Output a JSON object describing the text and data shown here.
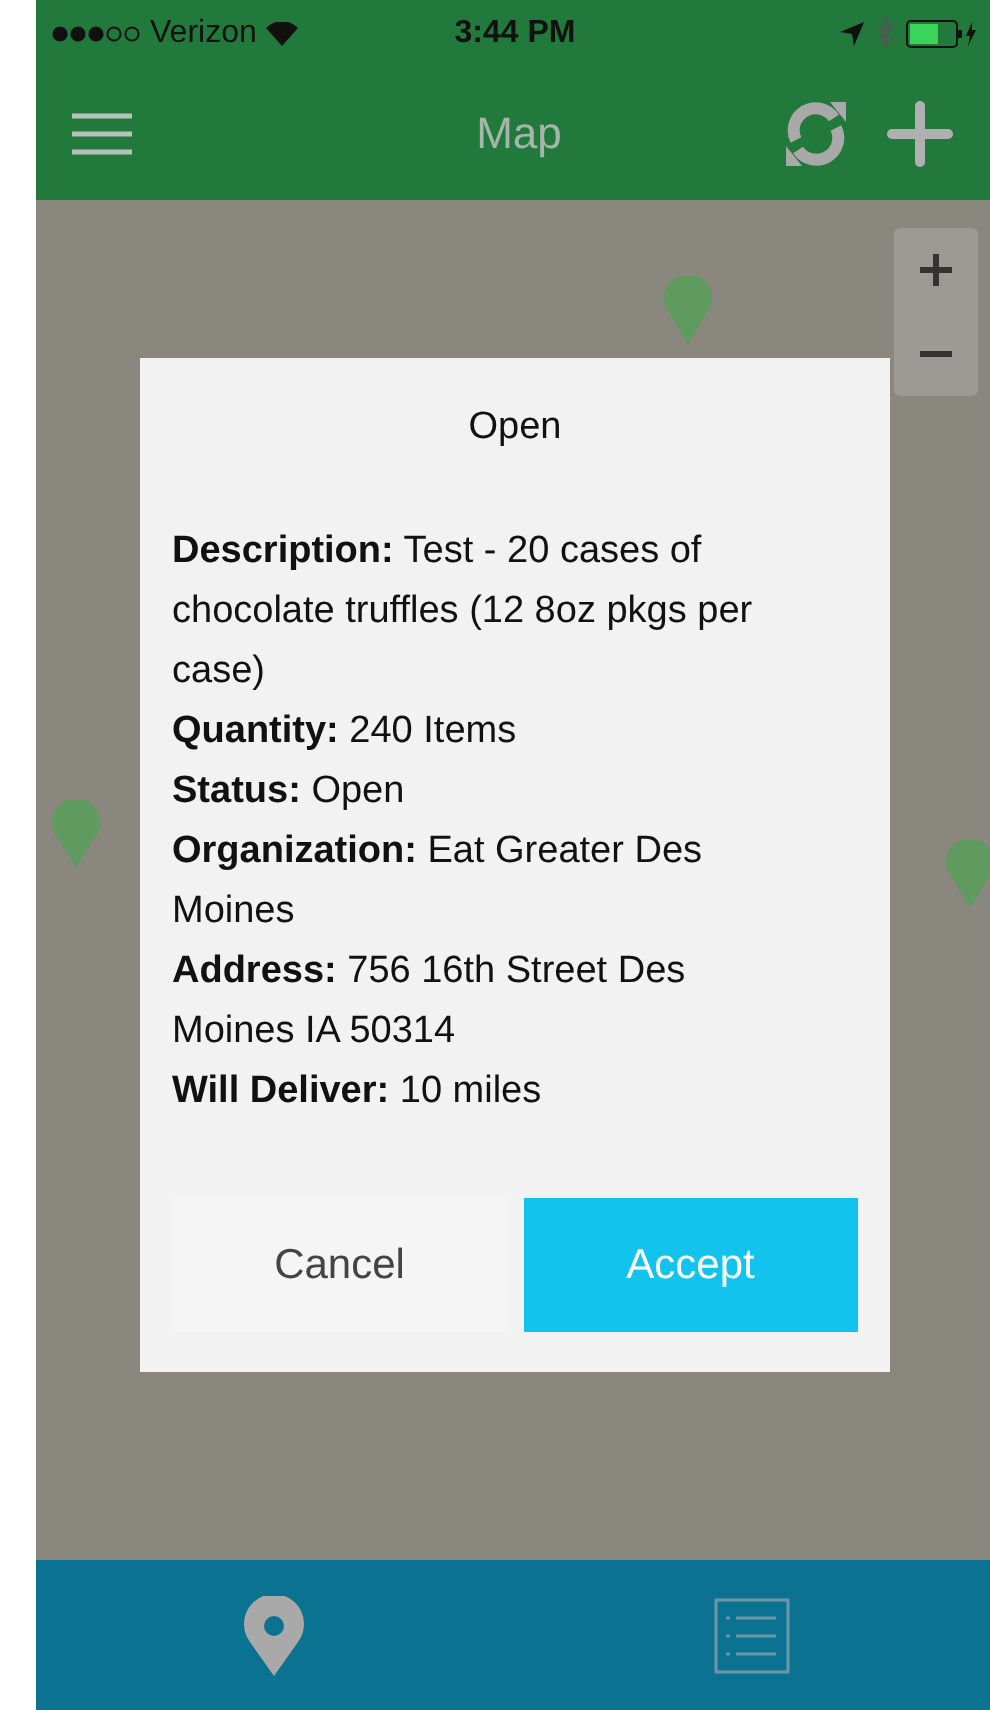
{
  "status_bar": {
    "carrier": "Verizon",
    "time": "3:44 PM"
  },
  "nav_bar": {
    "title": "Map"
  },
  "dialog": {
    "title": "Open",
    "fields": [
      {
        "label": "Description:",
        "value": "Test - 20 cases of chocolate truffles (12 8oz pkgs per case)"
      },
      {
        "label": "Quantity:",
        "value": "240 Items"
      },
      {
        "label": "Status:",
        "value": "Open"
      },
      {
        "label": "Organization:",
        "value": "Eat Greater Des Moines"
      },
      {
        "label": "Address:",
        "value": "756 16th Street Des Moines IA 50314"
      },
      {
        "label": "Will Deliver:",
        "value": "10 miles"
      }
    ],
    "buttons": [
      {
        "label": "Cancel",
        "kind": "secondary"
      },
      {
        "label": "Accept",
        "kind": "primary"
      }
    ]
  }
}
